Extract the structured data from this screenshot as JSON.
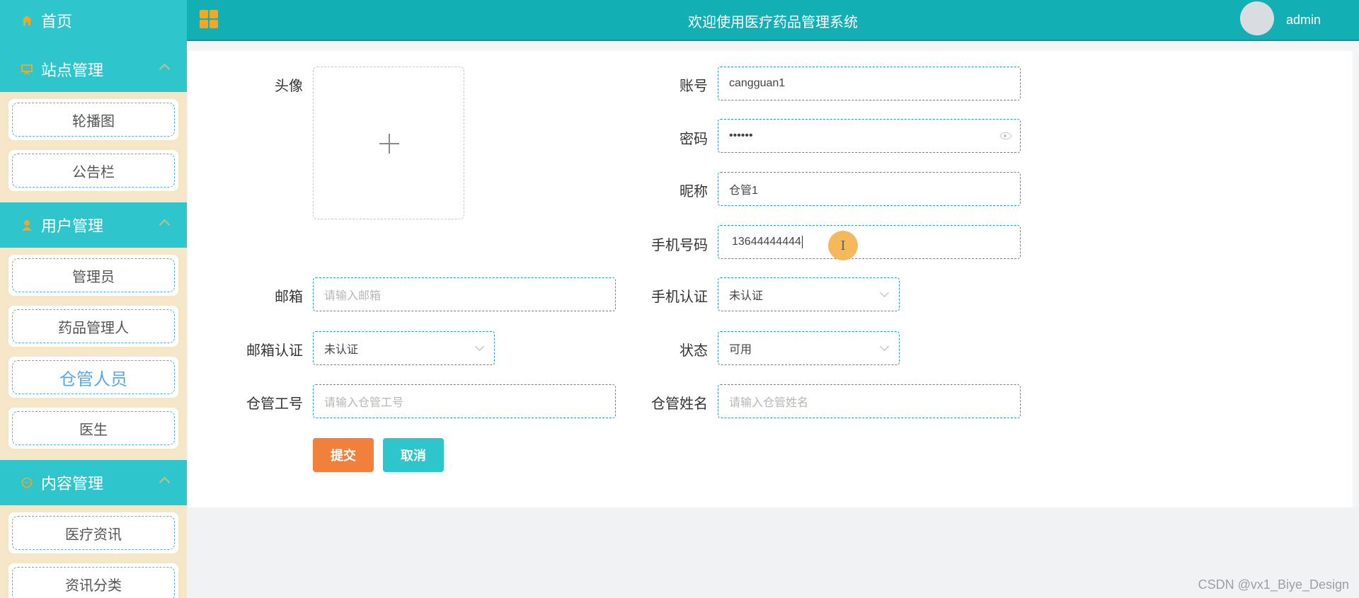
{
  "app": {
    "title": "欢迎使用医疗药品管理系统",
    "user": "admin"
  },
  "sidebar": {
    "home": "首页",
    "groups": [
      {
        "label": "站点管理",
        "items": [
          "轮播图",
          "公告栏"
        ]
      },
      {
        "label": "用户管理",
        "items": [
          "管理员",
          "药品管理人",
          "仓管人员",
          "医生"
        ]
      },
      {
        "label": "内容管理",
        "items": [
          "医疗资讯",
          "资讯分类"
        ]
      }
    ],
    "active_item": "仓管人员"
  },
  "form": {
    "avatar_label": "头像",
    "account": {
      "label": "账号",
      "value": "cangguan1"
    },
    "password": {
      "label": "密码",
      "value": "••••••"
    },
    "nickname": {
      "label": "昵称",
      "value": "仓管1"
    },
    "phone": {
      "label": "手机号码",
      "value": "13644444444"
    },
    "email": {
      "label": "邮箱",
      "placeholder": "请输入邮箱"
    },
    "phone_verify": {
      "label": "手机认证",
      "value": "未认证"
    },
    "email_verify": {
      "label": "邮箱认证",
      "value": "未认证"
    },
    "status": {
      "label": "状态",
      "value": "可用"
    },
    "staff_no": {
      "label": "仓管工号",
      "placeholder": "请输入仓管工号"
    },
    "staff_name": {
      "label": "仓管姓名",
      "placeholder": "请输入仓管姓名"
    },
    "submit": "提交",
    "cancel": "取消"
  },
  "colors": {
    "header": "#12b0b5",
    "sidebar_head": "#2ec5cc",
    "sidebar_bg": "#f5e6c8",
    "submit": "#f0803c",
    "cancel": "#2ec5cc"
  },
  "watermark": "CSDN @vx1_Biye_Design"
}
